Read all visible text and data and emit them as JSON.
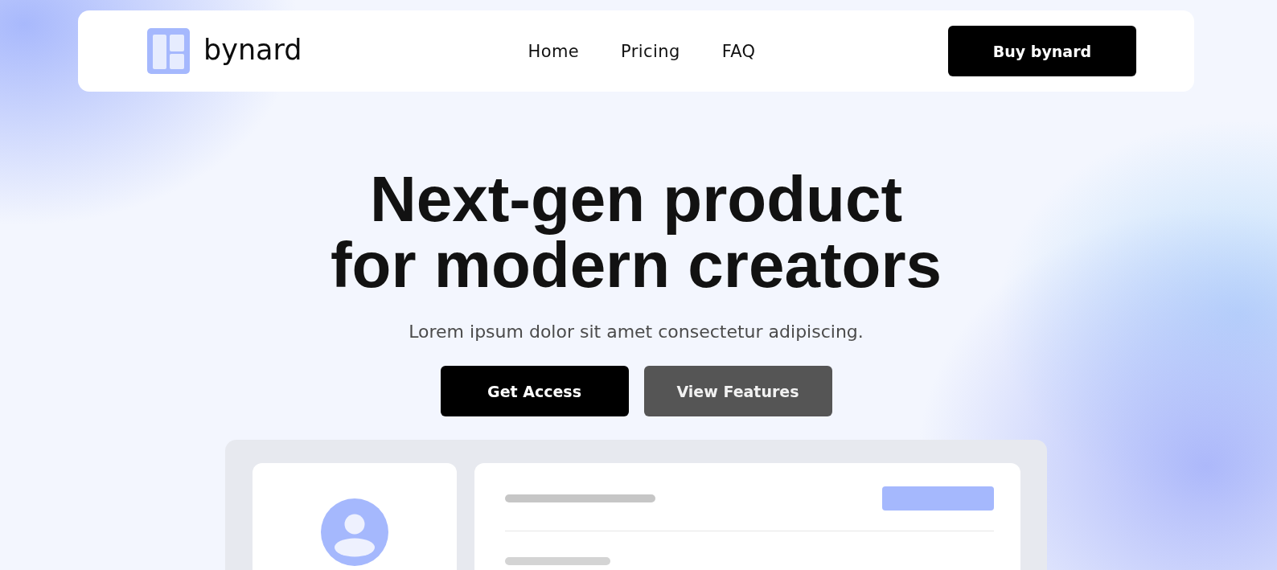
{
  "nav": {
    "brand": "bynard",
    "links": [
      "Home",
      "Pricing",
      "FAQ"
    ],
    "cta": "Buy bynard"
  },
  "hero": {
    "headline": "Next-gen product for modern creators",
    "subtitle": "Lorem ipsum dolor sit amet consectetur adipiscing.",
    "buttons": [
      {
        "label": "Get Access",
        "kind": "primary"
      },
      {
        "label": "View Features",
        "kind": "secondary"
      }
    ]
  }
}
